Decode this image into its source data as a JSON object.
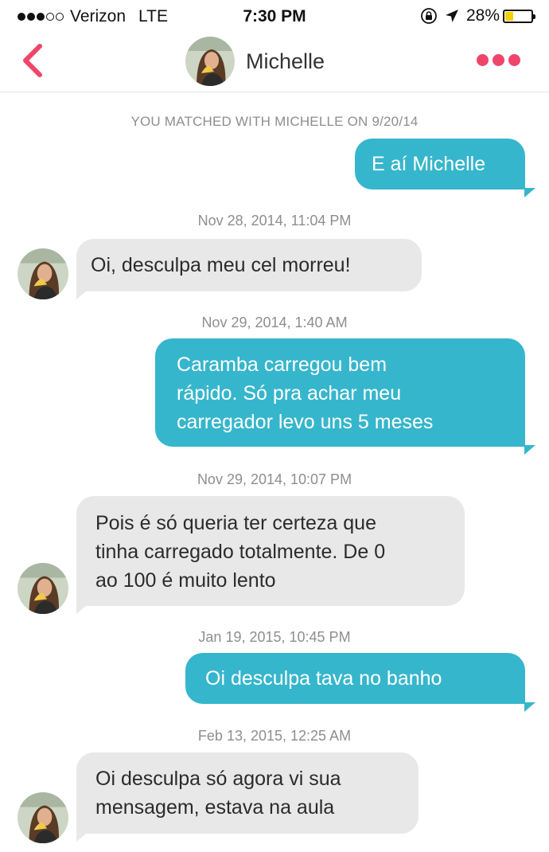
{
  "status_bar": {
    "carrier": "Verizon",
    "network": "LTE",
    "time": "7:30 PM",
    "battery": "28%",
    "battery_level": 0.28,
    "signal_bars": 3,
    "signal_total": 5
  },
  "header": {
    "contact_name": "Michelle",
    "accent_color": "#f0456b"
  },
  "chat": {
    "match_notice": "YOU MATCHED WITH MICHELLE ON 9/20/14",
    "outgoing_color": "#36b6cc",
    "incoming_color": "#e8e8e8",
    "messages": [
      {
        "direction": "out",
        "text": "E aí Michelle"
      },
      {
        "timestamp": "Nov 28, 2014, 11:04 PM",
        "direction": "in",
        "text": "Oi, desculpa meu cel morreu!"
      },
      {
        "timestamp": "Nov 29, 2014, 1:40 AM",
        "direction": "out",
        "lines": [
          "Caramba carregou bem",
          "rápido. Só pra achar meu",
          "carregador levo uns 5 meses"
        ]
      },
      {
        "timestamp": "Nov 29, 2014, 10:07 PM",
        "direction": "in",
        "lines": [
          "Pois é só queria ter certeza que",
          "tinha carregado totalmente. De 0",
          "ao 100 é muito lento"
        ]
      },
      {
        "timestamp": "Jan 19, 2015, 10:45 PM",
        "direction": "out",
        "text": "Oi desculpa tava no banho"
      },
      {
        "timestamp": "Feb 13, 2015, 12:25 AM",
        "direction": "in",
        "lines": [
          "Oi desculpa só agora vi sua",
          "mensagem, estava na aula"
        ]
      }
    ]
  }
}
